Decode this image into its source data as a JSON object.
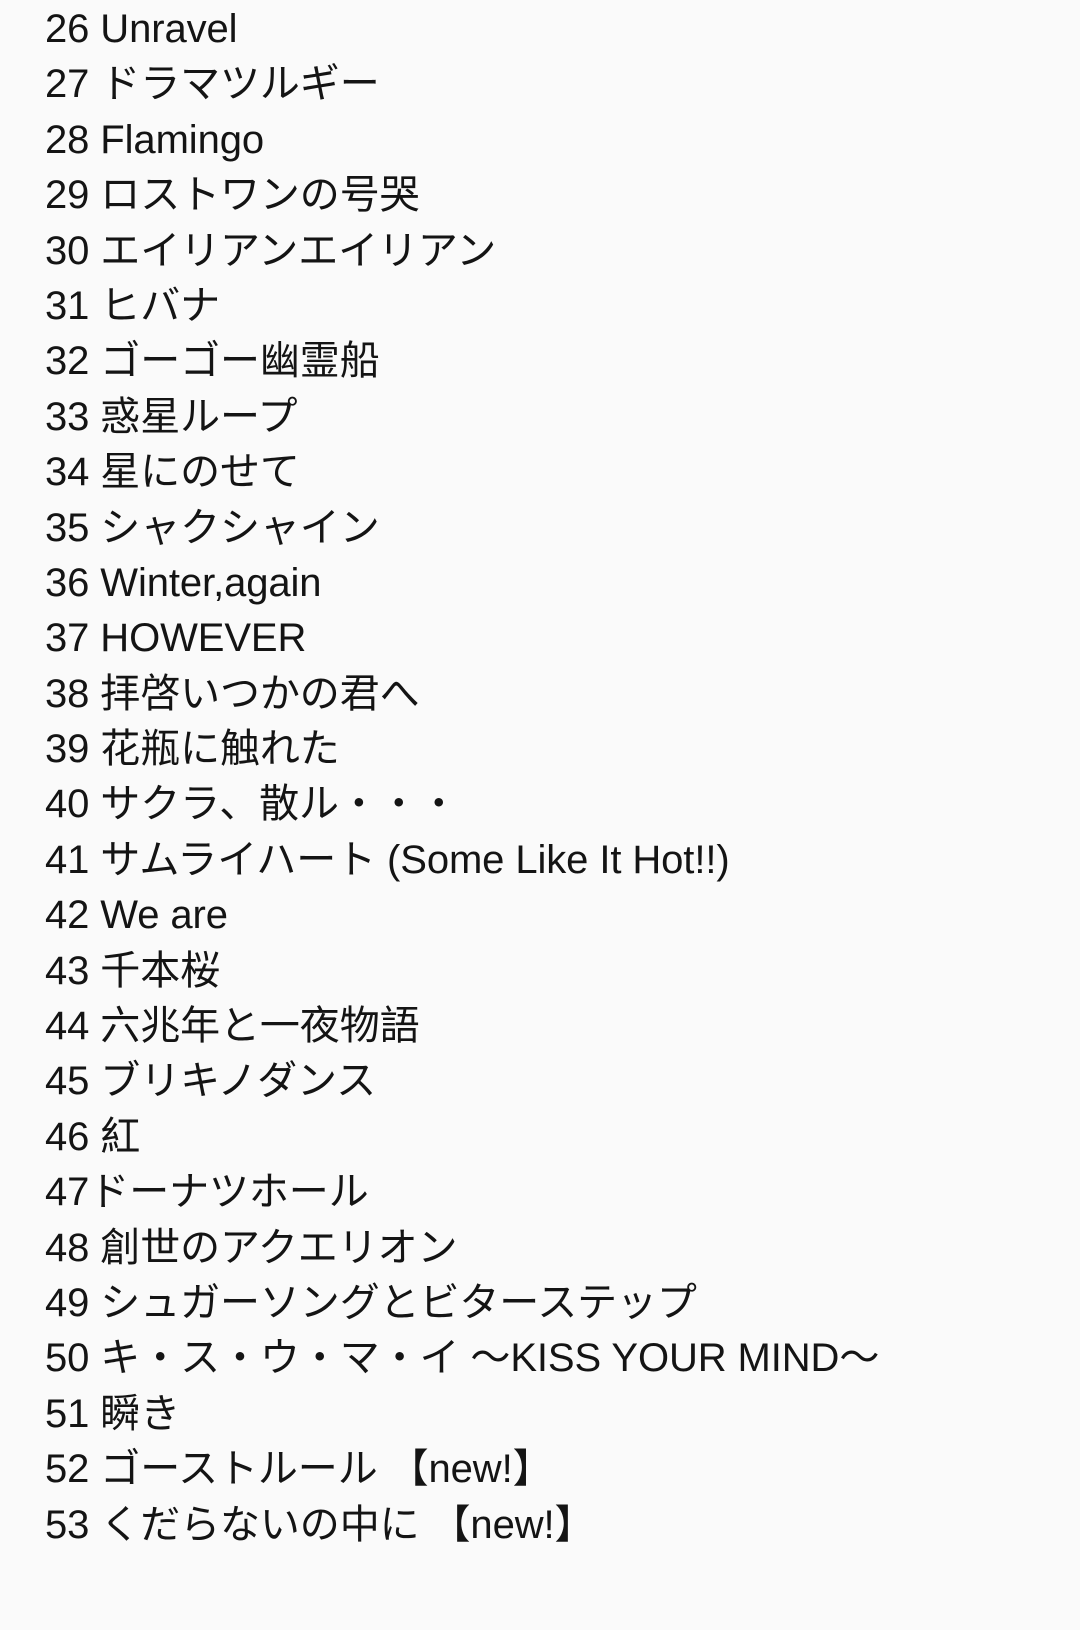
{
  "page": {
    "background_color": "#fafafa",
    "text_color": "#141414",
    "kind": "numbered-song-list",
    "first_index": 26,
    "last_index": 53
  },
  "list": {
    "rows": [
      {
        "index": "26",
        "separator": " ",
        "title": "Unravel",
        "line": "26 Unravel"
      },
      {
        "index": "27",
        "separator": " ",
        "title": "ドラマツルギー",
        "line": "27 ドラマツルギー"
      },
      {
        "index": "28",
        "separator": " ",
        "title": "Flamingo",
        "line": "28 Flamingo"
      },
      {
        "index": "29",
        "separator": " ",
        "title": "ロストワンの号哭",
        "line": "29 ロストワンの号哭"
      },
      {
        "index": "30",
        "separator": " ",
        "title": "エイリアンエイリアン",
        "line": "30 エイリアンエイリアン"
      },
      {
        "index": "31",
        "separator": " ",
        "title": "ヒバナ",
        "line": "31 ヒバナ"
      },
      {
        "index": "32",
        "separator": " ",
        "title": "ゴーゴー幽霊船",
        "line": "32 ゴーゴー幽霊船"
      },
      {
        "index": "33",
        "separator": " ",
        "title": "惑星ループ",
        "line": "33 惑星ループ"
      },
      {
        "index": "34",
        "separator": " ",
        "title": "星にのせて",
        "line": "34 星にのせて"
      },
      {
        "index": "35",
        "separator": " ",
        "title": "シャクシャイン",
        "line": "35 シャクシャイン"
      },
      {
        "index": "36",
        "separator": " ",
        "title": "Winter,again",
        "line": "36 Winter,again"
      },
      {
        "index": "37",
        "separator": " ",
        "title": "HOWEVER",
        "line": "37 HOWEVER"
      },
      {
        "index": "38",
        "separator": " ",
        "title": "拝啓いつかの君へ",
        "line": "38 拝啓いつかの君へ"
      },
      {
        "index": "39",
        "separator": " ",
        "title": "花瓶に触れた",
        "line": "39 花瓶に触れた"
      },
      {
        "index": "40",
        "separator": " ",
        "title": "サクラ、散ル・・・",
        "line": "40 サクラ、散ル・・・"
      },
      {
        "index": "41",
        "separator": " ",
        "title": "サムライハート (Some Like It Hot!!)",
        "line": "41 サムライハート (Some Like It Hot!!)"
      },
      {
        "index": "42",
        "separator": " ",
        "title": "We are",
        "line": "42 We are"
      },
      {
        "index": "43",
        "separator": " ",
        "title": "千本桜",
        "line": "43 千本桜"
      },
      {
        "index": "44",
        "separator": " ",
        "title": "六兆年と一夜物語",
        "line": "44 六兆年と一夜物語"
      },
      {
        "index": "45",
        "separator": " ",
        "title": "ブリキノダンス",
        "line": "45 ブリキノダンス"
      },
      {
        "index": "46",
        "separator": " ",
        "title": "紅",
        "line": "46 紅"
      },
      {
        "index": "47",
        "separator": "",
        "title": "ドーナツホール",
        "line": "47ドーナツホール"
      },
      {
        "index": "48",
        "separator": " ",
        "title": "創世のアクエリオン",
        "line": "48 創世のアクエリオン"
      },
      {
        "index": "49",
        "separator": " ",
        "title": "シュガーソングとビターステップ",
        "line": "49 シュガーソングとビターステップ"
      },
      {
        "index": "50",
        "separator": " ",
        "title": "キ・ス・ウ・マ・イ 〜KISS YOUR MIND〜",
        "line": "50 キ・ス・ウ・マ・イ 〜KISS YOUR MIND〜"
      },
      {
        "index": "51",
        "separator": " ",
        "title": "瞬き",
        "line": "51 瞬き"
      },
      {
        "index": "52",
        "separator": " ",
        "title": "ゴーストルール 【new!】",
        "line": "52 ゴーストルール 【new!】"
      },
      {
        "index": "53",
        "separator": " ",
        "title": "くだらないの中に 【new!】",
        "line": "53 くだらないの中に 【new!】"
      }
    ]
  }
}
